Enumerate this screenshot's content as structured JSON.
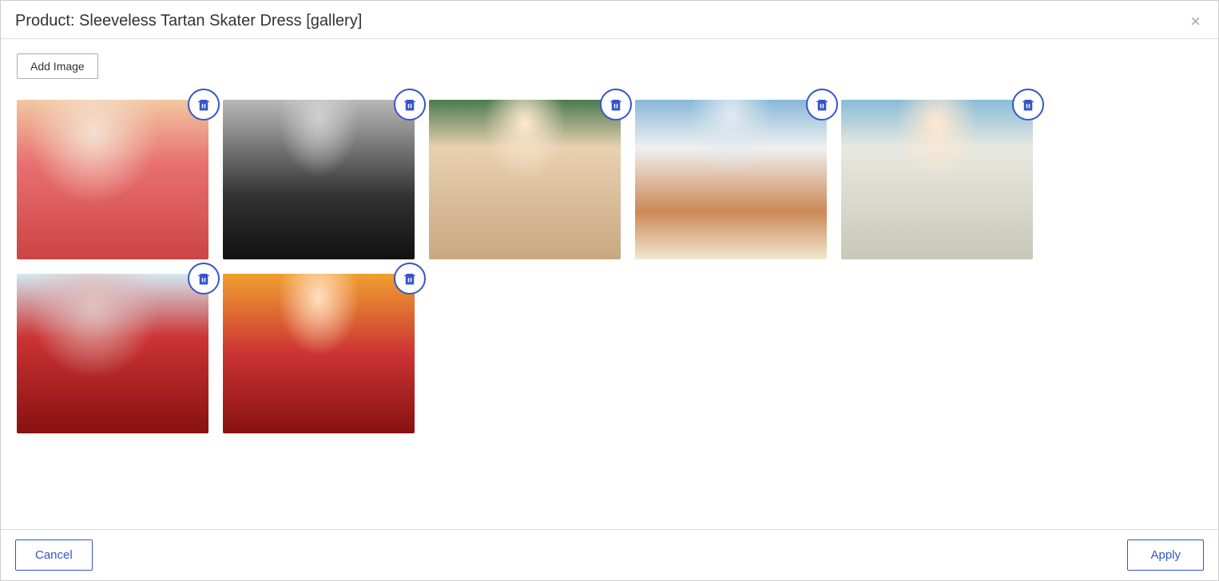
{
  "dialog": {
    "title": "Product: Sleeveless Tartan Skater Dress [gallery]",
    "close_label": "×",
    "add_image_label": "Add Image",
    "images": [
      {
        "id": 1,
        "alt": "Red floral dress model 1",
        "photo_class": "photo-1"
      },
      {
        "id": 2,
        "alt": "Black floral dress model",
        "photo_class": "photo-2"
      },
      {
        "id": 3,
        "alt": "Pink floral long dress",
        "photo_class": "photo-3"
      },
      {
        "id": 4,
        "alt": "White floral dress outdoor",
        "photo_class": "photo-4"
      },
      {
        "id": 5,
        "alt": "Light floral wrap dress balcony",
        "photo_class": "photo-5"
      },
      {
        "id": 6,
        "alt": "Dark red polka dot dress field",
        "photo_class": "photo-6"
      },
      {
        "id": 7,
        "alt": "Red dress orange background",
        "photo_class": "photo-7"
      }
    ],
    "footer": {
      "cancel_label": "Cancel",
      "apply_label": "Apply"
    }
  }
}
